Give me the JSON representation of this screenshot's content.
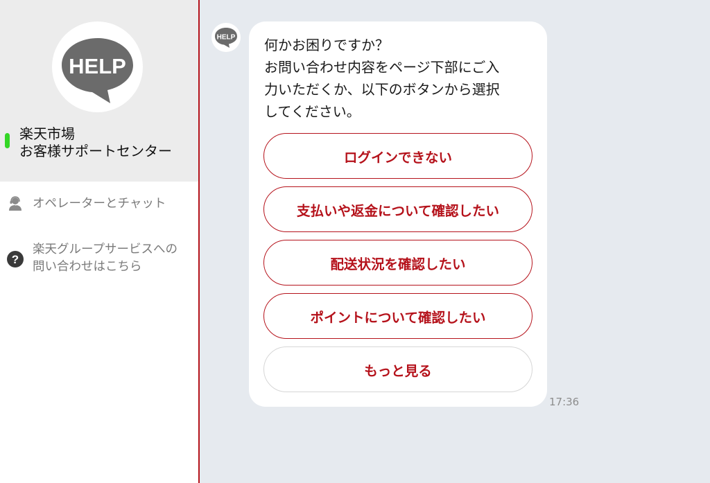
{
  "sidebar": {
    "logo_text": "HELP",
    "shop_name_line1": "楽天市場",
    "shop_name_line2": "お客様サポートセンター",
    "items": [
      {
        "icon": "operator-icon",
        "label": "オペレーターとチャット"
      },
      {
        "icon": "question-icon",
        "label_line1": "楽天グループサービスへの",
        "label_line2": "問い合わせはこちら"
      }
    ]
  },
  "chat": {
    "avatar_text": "HELP",
    "message_lines": [
      "何かお困りですか？",
      "お問い合わせ内容をページ下部にご入",
      "力いただくか、以下のボタンから選択",
      "してください。"
    ],
    "options": [
      "ログインできない",
      "支払いや返金について確認したい",
      "配送状況を確認したい",
      "ポイントについて確認したい",
      "もっと見る"
    ],
    "timestamp": "17:36"
  },
  "colors": {
    "accent": "#b5121b",
    "active_indicator": "#34d626",
    "chat_background": "#e6eaef",
    "sidebar_header": "#ececec"
  }
}
